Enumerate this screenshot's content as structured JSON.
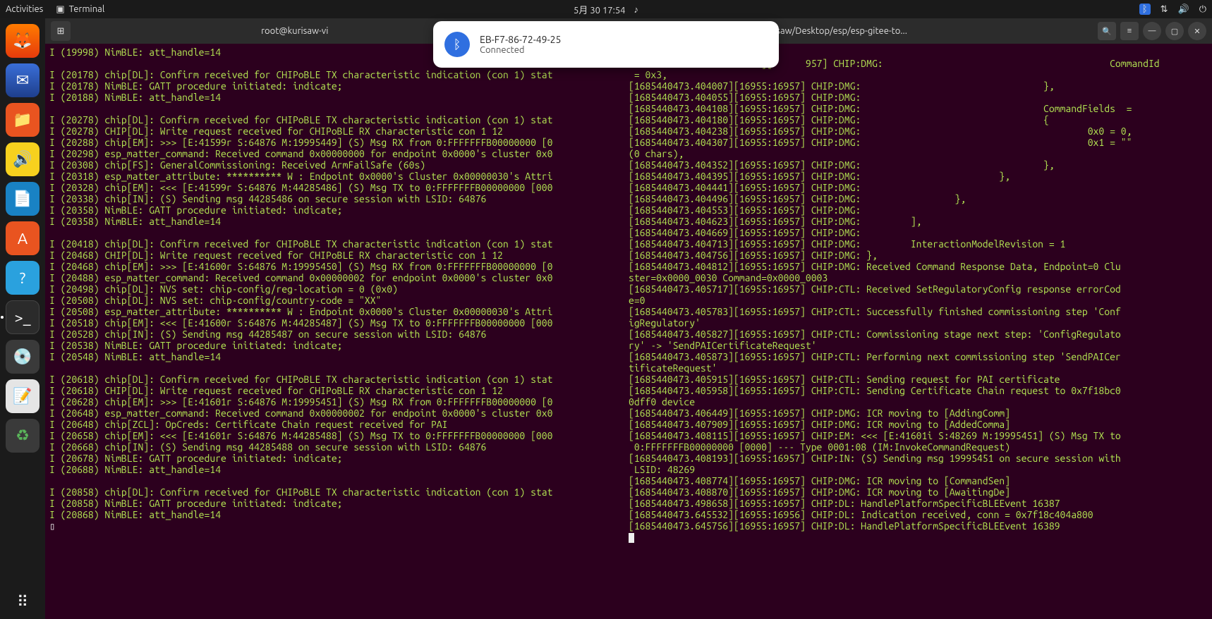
{
  "panel": {
    "activities": "Activities",
    "app_label": "Terminal",
    "datetime": "5月 30  17:54"
  },
  "notification": {
    "title": "EB-F7-86-72-49-25",
    "subtitle": "Connected"
  },
  "window": {
    "title_left": "root@kurisaw-vi",
    "title_right": "ine: /home/kurisaw/Desktop/esp/esp-gitee-to..."
  },
  "term_left": [
    "I (19998) NimBLE: att_handle=14",
    "",
    "I (20178) chip[DL]: Confirm received for CHIPoBLE TX characteristic indication (con 1) stat",
    "I (20178) NimBLE: GATT procedure initiated: indicate;",
    "I (20188) NimBLE: att_handle=14",
    "",
    "I (20278) chip[DL]: Confirm received for CHIPoBLE TX characteristic indication (con 1) stat",
    "I (20278) CHIP[DL]: Write request received for CHIPoBLE RX characteristic con 1 12",
    "I (20288) chip[EM]: >>> [E:41599r S:64876 M:19995449] (S) Msg RX from 0:FFFFFFFB00000000 [0",
    "I (20298) esp_matter_command: Received command 0x00000000 for endpoint 0x0000's cluster 0x0",
    "I (20308) chip[FS]: GeneralCommissioning: Received ArmFailSafe (60s)",
    "I (20318) esp_matter_attribute: ********** W : Endpoint 0x0000's Cluster 0x00000030's Attri",
    "I (20328) chip[EM]: <<< [E:41599r S:64876 M:44285486] (S) Msg TX to 0:FFFFFFFB00000000 [000",
    "I (20338) chip[IN]: (S) Sending msg 44285486 on secure session with LSID: 64876",
    "I (20358) NimBLE: GATT procedure initiated: indicate;",
    "I (20358) NimBLE: att_handle=14",
    "",
    "I (20418) chip[DL]: Confirm received for CHIPoBLE TX characteristic indication (con 1) stat",
    "I (20468) CHIP[DL]: Write request received for CHIPoBLE RX characteristic con 1 12",
    "I (20468) chip[EM]: >>> [E:41600r S:64876 M:19995450] (S) Msg RX from 0:FFFFFFFB00000000 [0",
    "I (20488) esp_matter_command: Received command 0x00000002 for endpoint 0x0000's cluster 0x0",
    "I (20498) chip[DL]: NVS set: chip-config/reg-location = 0 (0x0)",
    "I (20508) chip[DL]: NVS set: chip-config/country-code = \"XX\"",
    "I (20508) esp_matter_attribute: ********** W : Endpoint 0x0000's Cluster 0x00000030's Attri",
    "I (20518) chip[EM]: <<< [E:41600r S:64876 M:44285487] (S) Msg TX to 0:FFFFFFFB00000000 [000",
    "I (20528) chip[IN]: (S) Sending msg 44285487 on secure session with LSID: 64876",
    "I (20538) NimBLE: GATT procedure initiated: indicate;",
    "I (20548) NimBLE: att_handle=14",
    "",
    "I (20618) chip[DL]: Confirm received for CHIPoBLE TX characteristic indication (con 1) stat",
    "I (20618) CHIP[DL]: Write request received for CHIPoBLE RX characteristic con 1 12",
    "I (20628) chip[EM]: >>> [E:41601r S:64876 M:19995451] (S) Msg RX from 0:FFFFFFFB00000000 [0",
    "I (20648) esp_matter_command: Received command 0x00000002 for endpoint 0x0000's cluster 0x0",
    "I (20648) chip[ZCL]: OpCreds: Certificate Chain request received for PAI",
    "I (20658) chip[EM]: <<< [E:41601r S:64876 M:44285488] (S) Msg TX to 0:FFFFFFFB00000000 [000",
    "I (20668) chip[IN]: (S) Sending msg 44285488 on secure session with LSID: 64876",
    "I (20678) NimBLE: GATT procedure initiated: indicate;",
    "I (20688) NimBLE: att_handle=14",
    "",
    "I (20858) chip[DL]: Confirm received for CHIPoBLE TX characteristic indication (con 1) stat",
    "I (20858) NimBLE: GATT procedure initiated: indicate;",
    "I (20868) NimBLE: att_handle=14"
  ],
  "term_right": [
    "",
    "                        ][      957] CHIP:DMG:                                         CommandId",
    " = 0x3,",
    "[1685440473.404007][16955:16957] CHIP:DMG:                                 },",
    "[1685440473.404055][16955:16957] CHIP:DMG:",
    "[1685440473.404108][16955:16957] CHIP:DMG:                                 CommandFields  =",
    "[1685440473.404180][16955:16957] CHIP:DMG:                                 {",
    "[1685440473.404238][16955:16957] CHIP:DMG:                                         0x0 = 0,",
    "[1685440473.404307][16955:16957] CHIP:DMG:                                         0x1 = \"\"",
    "(0 chars),",
    "[1685440473.404352][16955:16957] CHIP:DMG:                                 },",
    "[1685440473.404395][16955:16957] CHIP:DMG:                         },",
    "[1685440473.404441][16955:16957] CHIP:DMG:",
    "[1685440473.404496][16955:16957] CHIP:DMG:                 },",
    "[1685440473.404553][16955:16957] CHIP:DMG:",
    "[1685440473.404623][16955:16957] CHIP:DMG:         ],",
    "[1685440473.404669][16955:16957] CHIP:DMG:",
    "[1685440473.404713][16955:16957] CHIP:DMG:         InteractionModelRevision = 1",
    "[1685440473.404756][16955:16957] CHIP:DMG: },",
    "[1685440473.404812][16955:16957] CHIP:DMG: Received Command Response Data, Endpoint=0 Clu",
    "ster=0x0000_0030 Command=0x0000_0003",
    "[1685440473.405717][16955:16957] CHIP:CTL: Received SetRegulatoryConfig response errorCod",
    "e=0",
    "[1685440473.405783][16955:16957] CHIP:CTL: Successfully finished commissioning step 'Conf",
    "igRegulatory'",
    "[1685440473.405827][16955:16957] CHIP:CTL: Commissioning stage next step: 'ConfigRegulato",
    "ry' -> 'SendPAICertificateRequest'",
    "[1685440473.405873][16955:16957] CHIP:CTL: Performing next commissioning step 'SendPAICer",
    "tificateRequest'",
    "[1685440473.405915][16955:16957] CHIP:CTL: Sending request for PAI certificate",
    "[1685440473.405958][16955:16957] CHIP:CTL: Sending Certificate Chain request to 0x7f18bc0",
    "0dff0 device",
    "[1685440473.406449][16955:16957] CHIP:DMG: ICR moving to [AddingComm]",
    "[1685440473.407909][16955:16957] CHIP:DMG: ICR moving to [AddedComma]",
    "[1685440473.408115][16955:16957] CHIP:EM: <<< [E:41601i S:48269 M:19995451] (S) Msg TX to",
    " 0:FFFFFFFB00000000 [0000] --- Type 0001:08 (IM:InvokeCommandRequest)",
    "[1685440473.408193][16955:16957] CHIP:IN: (S) Sending msg 19995451 on secure session with",
    " LSID: 48269",
    "[1685440473.408774][16955:16957] CHIP:DMG: ICR moving to [CommandSen]",
    "[1685440473.408870][16955:16957] CHIP:DMG: ICR moving to [AwaitingDe]",
    "[1685440473.498658][16955:16957] CHIP:DL: HandlePlatformSpecificBLEEvent 16387",
    "[1685440473.645532][16955:16956] CHIP:DL: Indication received, conn = 0x7f18c404a800",
    "[1685440473.645756][16955:16957] CHIP:DL: HandlePlatformSpecificBLEEvent 16389"
  ]
}
